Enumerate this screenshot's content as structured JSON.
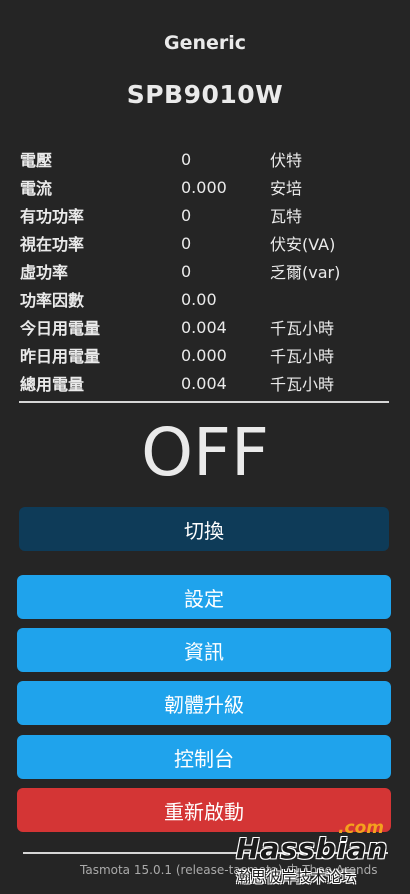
{
  "header": {
    "module": "Generic",
    "device": "SPB9010W"
  },
  "sensors": [
    {
      "label": "電壓",
      "value": "0",
      "unit": "伏特"
    },
    {
      "label": "電流",
      "value": "0.000",
      "unit": "安培"
    },
    {
      "label": "有功功率",
      "value": "0",
      "unit": "瓦特"
    },
    {
      "label": "視在功率",
      "value": "0",
      "unit": "伏安(VA)"
    },
    {
      "label": "虛功率",
      "value": "0",
      "unit": "乏爾(var)"
    },
    {
      "label": "功率因數",
      "value": "0.00",
      "unit": ""
    },
    {
      "label": "今日用電量",
      "value": "0.004",
      "unit": "千瓦小時"
    },
    {
      "label": "昨日用電量",
      "value": "0.000",
      "unit": "千瓦小時"
    },
    {
      "label": "總用電量",
      "value": "0.004",
      "unit": "千瓦小時"
    }
  ],
  "power_state": "OFF",
  "buttons": {
    "toggle": "切換",
    "config": "設定",
    "info": "資訊",
    "upgrade": "韌體升級",
    "console": "控制台",
    "restart": "重新啟動"
  },
  "footer": "Tasmota 15.0.1 (release-tasmota) 由 Theo Arends",
  "watermark": {
    "com": ".com",
    "name": "Hassbian",
    "sub": "瀚思彼岸技术论坛"
  },
  "colors": {
    "background": "#252525",
    "button_blue": "#1fa3ec",
    "button_toggle": "#0e3b58",
    "button_red": "#d43535"
  }
}
